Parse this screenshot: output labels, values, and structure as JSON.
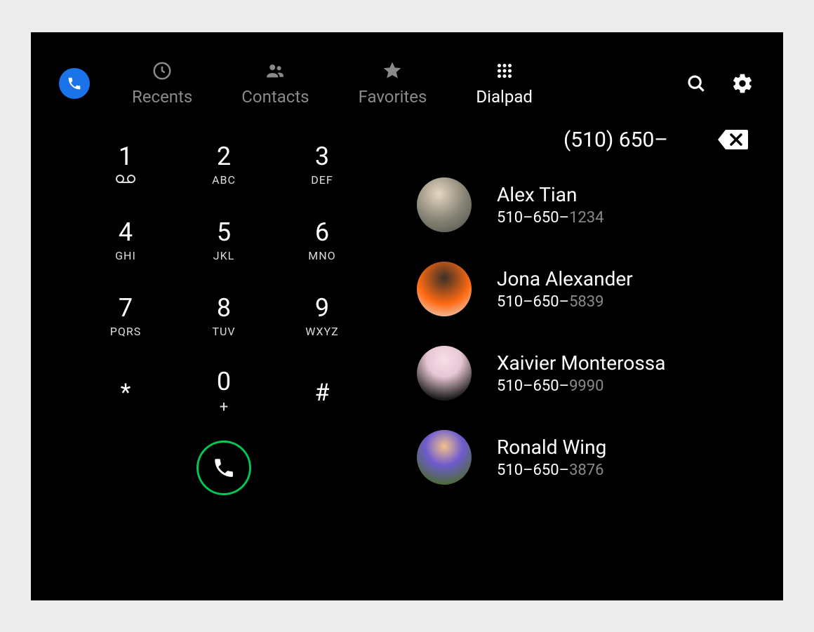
{
  "colors": {
    "accent_blue": "#1a73e8",
    "call_green": "#00c853",
    "inactive_grey": "#8a8a8a"
  },
  "tabs": [
    {
      "id": "recents",
      "label": "Recents",
      "icon": "clock-icon"
    },
    {
      "id": "contacts",
      "label": "Contacts",
      "icon": "people-icon"
    },
    {
      "id": "favorites",
      "label": "Favorites",
      "icon": "star-icon"
    },
    {
      "id": "dialpad",
      "label": "Dialpad",
      "icon": "keypad-icon"
    }
  ],
  "active_tab": "dialpad",
  "dialpad": {
    "keys": [
      {
        "digit": "1",
        "sub": "voicemail"
      },
      {
        "digit": "2",
        "sub": "ABC"
      },
      {
        "digit": "3",
        "sub": "DEF"
      },
      {
        "digit": "4",
        "sub": "GHI"
      },
      {
        "digit": "5",
        "sub": "JKL"
      },
      {
        "digit": "6",
        "sub": "MNO"
      },
      {
        "digit": "7",
        "sub": "PQRS"
      },
      {
        "digit": "8",
        "sub": "TUV"
      },
      {
        "digit": "9",
        "sub": "WXYZ"
      },
      {
        "digit": "*",
        "sub": ""
      },
      {
        "digit": "0",
        "sub": "+"
      },
      {
        "digit": "#",
        "sub": ""
      }
    ]
  },
  "dialed": "(510) 650–",
  "dialed_prefix": "510–650–",
  "suggestions": [
    {
      "name": "Alex Tian",
      "suffix": "1234"
    },
    {
      "name": "Jona Alexander",
      "suffix": "5839"
    },
    {
      "name": "Xaivier Monterossa",
      "suffix": "9990"
    },
    {
      "name": "Ronald Wing",
      "suffix": "3876"
    }
  ]
}
